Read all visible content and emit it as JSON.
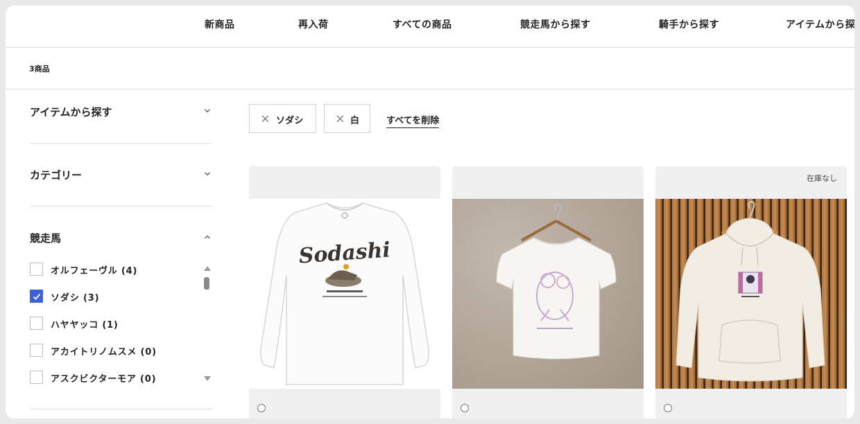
{
  "nav": {
    "items": [
      "新商品",
      "再入荷",
      "すべての商品",
      "競走馬から探す",
      "騎手から探す",
      "アイテムから探す"
    ]
  },
  "result_count": "3商品",
  "sidebar": {
    "facets": [
      {
        "title": "アイテムから探す",
        "expanded": false
      },
      {
        "title": "カテゴリー",
        "expanded": false
      },
      {
        "title": "競走馬",
        "expanded": true
      }
    ],
    "horse_options": [
      {
        "label": "オルフェーヴル (4)",
        "checked": false
      },
      {
        "label": "ソダシ (3)",
        "checked": true
      },
      {
        "label": "ハヤヤッコ (1)",
        "checked": false
      },
      {
        "label": "アカイトリノムスメ (0)",
        "checked": false
      },
      {
        "label": "アスクビクターモア (0)",
        "checked": false
      }
    ]
  },
  "active_filters": [
    "ソダシ",
    "白"
  ],
  "clear_all_label": "すべてを削除",
  "products": [
    {
      "badge": "",
      "print_text": "Sodashi"
    },
    {
      "badge": "",
      "print_text": ""
    },
    {
      "badge": "在庫なし",
      "print_text": ""
    }
  ],
  "colors": {
    "accent_checkbox": "#3d63d3",
    "divider": "#dcdcdc",
    "card_bg": "#f0f0f0"
  }
}
